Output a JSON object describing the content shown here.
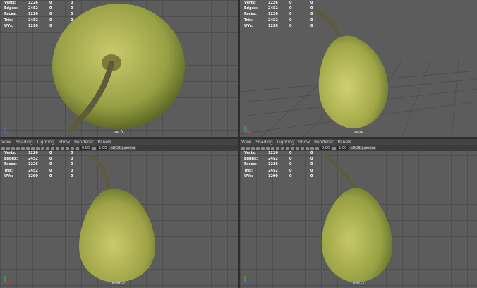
{
  "menu": [
    "View",
    "Shading",
    "Lighting",
    "Show",
    "Renderer",
    "Panels"
  ],
  "toolbar": {
    "value_a": "0.00",
    "value_b": "1.00",
    "gamma": "sRGB gamma"
  },
  "hud": [
    {
      "label": "Verts:",
      "v1": "1226",
      "v2": "0",
      "v3": "0"
    },
    {
      "label": "Edges:",
      "v1": "2452",
      "v2": "0",
      "v3": "0"
    },
    {
      "label": "Faces:",
      "v1": "1226",
      "v2": "0",
      "v3": "0"
    },
    {
      "label": "Tris:",
      "v1": "2452",
      "v2": "0",
      "v3": "0"
    },
    {
      "label": "UVs:",
      "v1": "1290",
      "v2": "0",
      "v3": "0"
    }
  ],
  "viewports": {
    "top": {
      "camera": "top -Y"
    },
    "persp": {
      "camera": "persp"
    },
    "front": {
      "camera": "front -Z"
    },
    "side": {
      "camera": "side -X"
    }
  },
  "colors": {
    "pear_light": "#c9cb6a",
    "pear_dark": "#6f7a2c",
    "stem": "#5d5b3a",
    "viewport_bg": "#5c5c5c"
  }
}
